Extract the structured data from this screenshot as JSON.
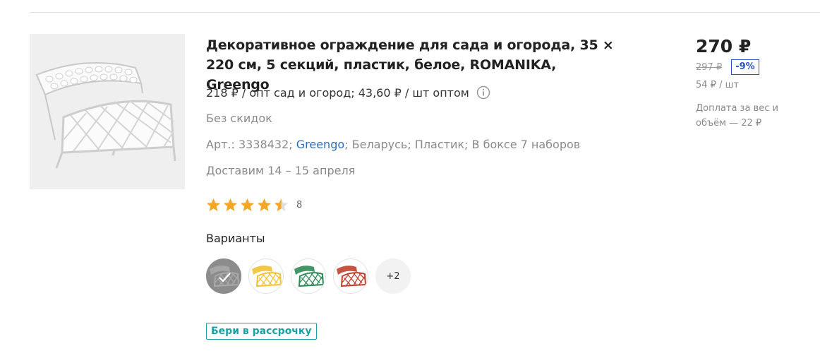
{
  "product": {
    "image_alt": "Декоративное ограждение",
    "title": "Декоративное ограждение для сада и огорода, 35 × 220 см, 5 секций, пластик, белое, ROMANIKA, Greengo",
    "opt_price": "218 ₽ / опт сад и огород; 43,60 ₽ / шт оптом",
    "no_discount": "Без скидок",
    "specs": {
      "article": "Арт.: 3338432;",
      "brand": "Greengo",
      "rest": "; Беларусь; Пластик; В боксе 7 наборов"
    },
    "delivery": "Доставим 14 – 15 апреля",
    "rating": {
      "value": 4.5,
      "max": 5,
      "count": "8",
      "star_color": "#f5a623"
    },
    "variants_heading": "Варианты",
    "variants": [
      {
        "color": "#8c8c8c",
        "selected": true,
        "name": "white"
      },
      {
        "color": "#f2c232",
        "selected": false,
        "name": "yellow"
      },
      {
        "color": "#2e8b57",
        "selected": false,
        "name": "green"
      },
      {
        "color": "#c0412b",
        "selected": false,
        "name": "red"
      }
    ],
    "more_variants": "+2",
    "installment_label": "Бери в рассрочку"
  },
  "pricing": {
    "price": "270 ₽",
    "old_price": "297 ₽",
    "discount": "-9%",
    "unit_price": "54 ₽ / шт",
    "surcharge": "Доплата за вес и объём — 22 ₽"
  },
  "colors": {
    "accent_link": "#2f6db7",
    "installment": "#1ba0a8",
    "discount_badge": "#2a55c8"
  }
}
